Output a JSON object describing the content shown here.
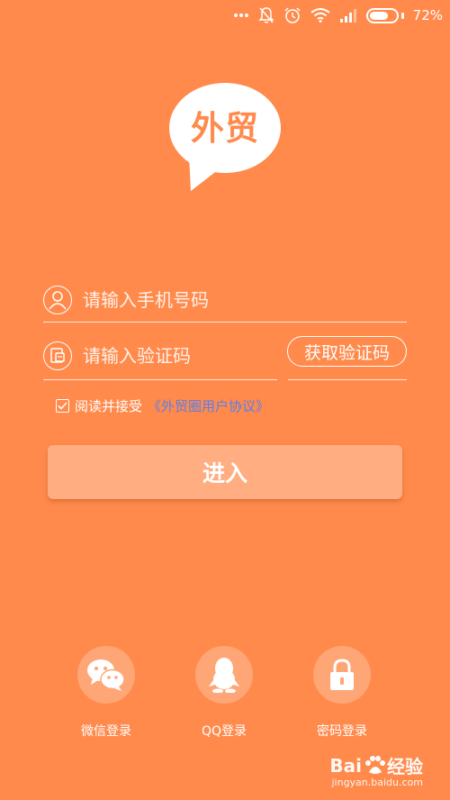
{
  "status_bar": {
    "icons": [
      "more-dots-icon",
      "notification-muted-icon",
      "alarm-icon",
      "wifi-icon",
      "signal-icon",
      "battery-icon"
    ],
    "battery_level": 0.72,
    "battery_text": "72%"
  },
  "logo": {
    "text": "外贸"
  },
  "login": {
    "phone_placeholder": "请输入手机号码",
    "code_placeholder": "请输入验证码",
    "get_code_label": "获取验证码",
    "agreement_checked": true,
    "agreement_text": "阅读并接受",
    "agreement_link": "《外贸圈用户协议》",
    "submit_label": "进入"
  },
  "social_login": [
    {
      "label": "微信登录",
      "icon": "wechat-icon"
    },
    {
      "label": "QQ登录",
      "icon": "qq-penguin-icon"
    },
    {
      "label": "密码登录",
      "icon": "lock-icon"
    }
  ],
  "watermark": {
    "brand": "Bai",
    "brand_cn": "经验",
    "url": "jingyan.baidu.com"
  },
  "colors": {
    "background": "#FF8A4C",
    "button": "#FFAD81",
    "social_circle": "#FFA676",
    "link": "#5B7FE8"
  }
}
